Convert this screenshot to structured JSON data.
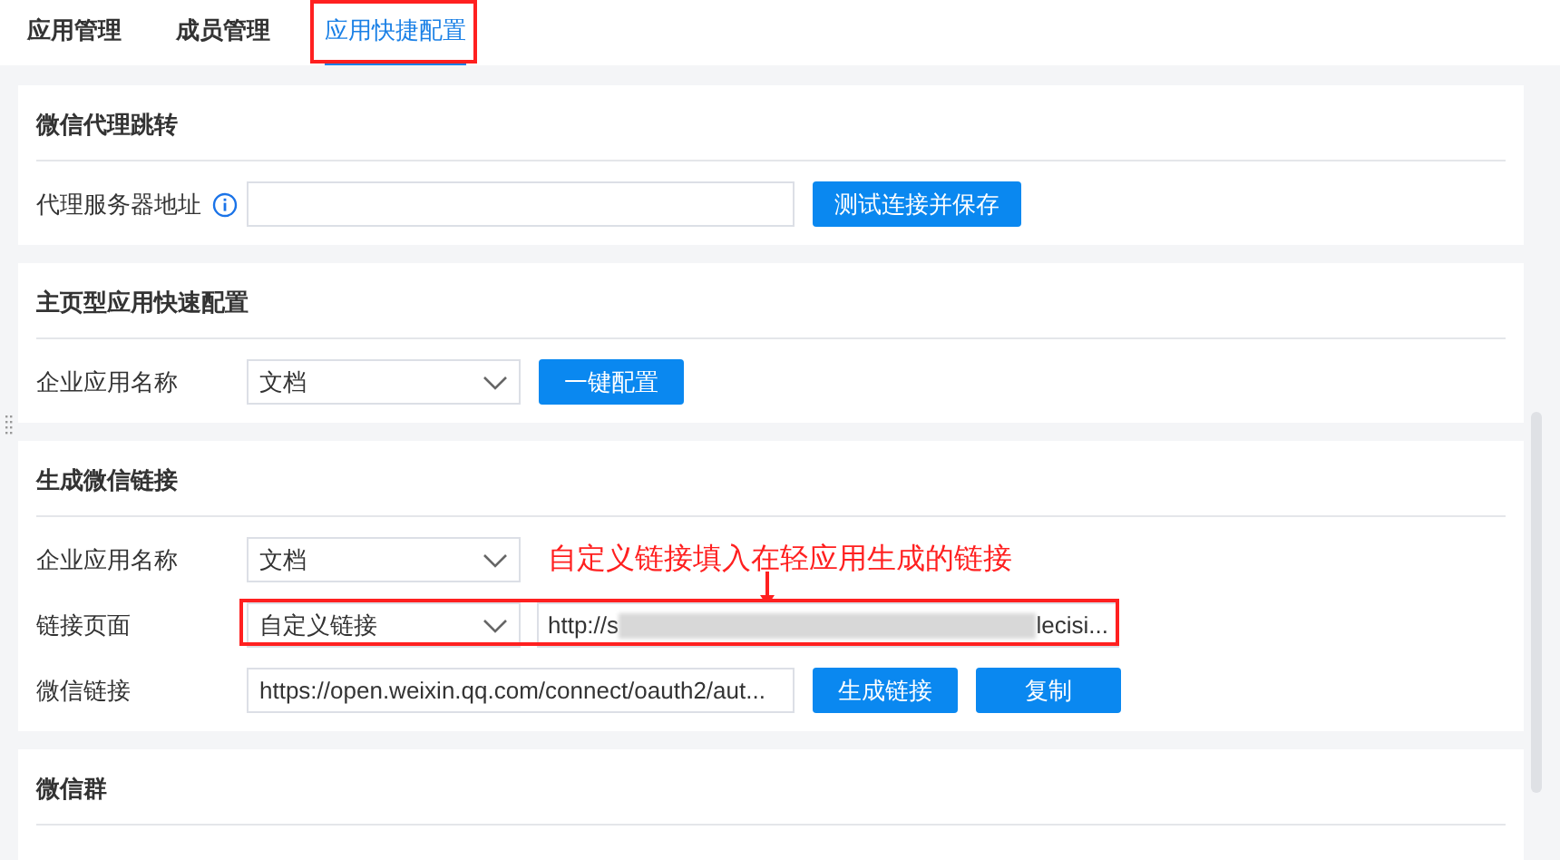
{
  "tabs": [
    {
      "label": "应用管理",
      "selected": false,
      "highlighted": false
    },
    {
      "label": "成员管理",
      "selected": false,
      "highlighted": false
    },
    {
      "label": "应用快捷配置",
      "selected": true,
      "highlighted": true
    }
  ],
  "sections": [
    {
      "title": "微信代理跳转",
      "rows": [
        {
          "kind": "input",
          "label": "代理服务器地址",
          "info": true,
          "buttons": [
            "测试连接并保存"
          ]
        }
      ]
    },
    {
      "title": "主页型应用快速配置",
      "rows": [
        {
          "kind": "select",
          "label": "企业应用名称",
          "value": "文档",
          "buttons": [
            "一键配置"
          ]
        }
      ]
    },
    {
      "title": "生成微信链接",
      "rows": [
        {
          "kind": "select",
          "label": "企业应用名称",
          "value": "文档",
          "note": "自定义链接填入在轻应用生成的链接"
        },
        {
          "kind": "select-url",
          "label": "链接页面",
          "value": "自定义链接",
          "url_start": "http://s",
          "url_end": "lecisi...",
          "highlighted": true
        },
        {
          "kind": "input",
          "label": "微信链接",
          "value": "https://open.weixin.qq.com/connect/oauth2/aut...",
          "buttons": [
            "生成链接",
            "复制"
          ]
        }
      ]
    },
    {
      "title": "微信群"
    }
  ]
}
